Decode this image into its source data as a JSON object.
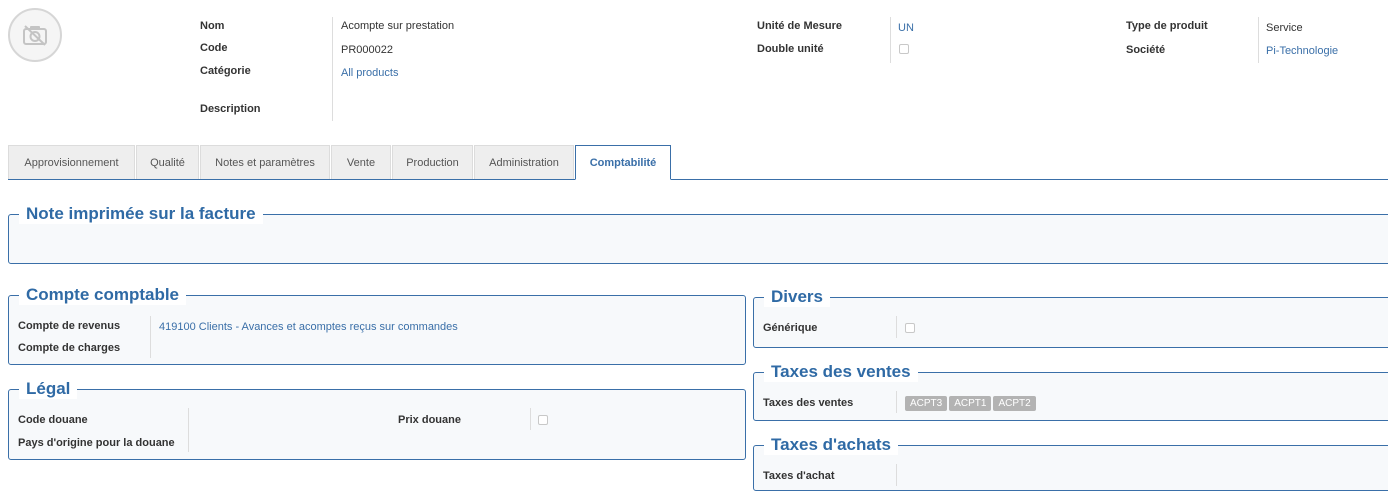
{
  "header": {
    "labels": {
      "name": "Nom",
      "code": "Code",
      "category": "Catégorie",
      "description": "Description",
      "uom": "Unité de Mesure",
      "double_unit": "Double unité",
      "product_type": "Type de produit",
      "company": "Société"
    },
    "values": {
      "name": "Acompte sur prestation",
      "code": "PR000022",
      "category": "All products",
      "description": "",
      "uom": "UN",
      "product_type": "Service",
      "company": "Pi-Technologie"
    },
    "avatar_icon": "camera-off-icon"
  },
  "tabs": [
    {
      "label": "Approvisionnement"
    },
    {
      "label": "Qualité"
    },
    {
      "label": "Notes et paramètres"
    },
    {
      "label": "Vente"
    },
    {
      "label": "Production"
    },
    {
      "label": "Administration"
    },
    {
      "label": "Comptabilité",
      "active": true
    }
  ],
  "sections": {
    "invoice_note": {
      "title": "Note imprimée sur la facture"
    },
    "accounting": {
      "title": "Compte comptable",
      "revenue_label": "Compte de revenus",
      "revenue_value": "419100 Clients - Avances et acomptes reçus sur commandes",
      "expense_label": "Compte de charges"
    },
    "legal": {
      "title": "Légal",
      "customs_code_label": "Code douane",
      "customs_price_label": "Prix douane",
      "origin_label": "Pays d'origine pour la douane"
    },
    "misc": {
      "title": "Divers",
      "generic_label": "Générique"
    },
    "sales_taxes": {
      "title": "Taxes des ventes",
      "label": "Taxes des ventes",
      "tags": [
        "ACPT3",
        "ACPT1",
        "ACPT2"
      ]
    },
    "purchase_taxes": {
      "title": "Taxes d'achats",
      "label": "Taxes d'achat"
    }
  },
  "colors": {
    "accent": "#3a6fa8",
    "legend": "#2f6aa5",
    "tag": "#b3b3b3"
  }
}
